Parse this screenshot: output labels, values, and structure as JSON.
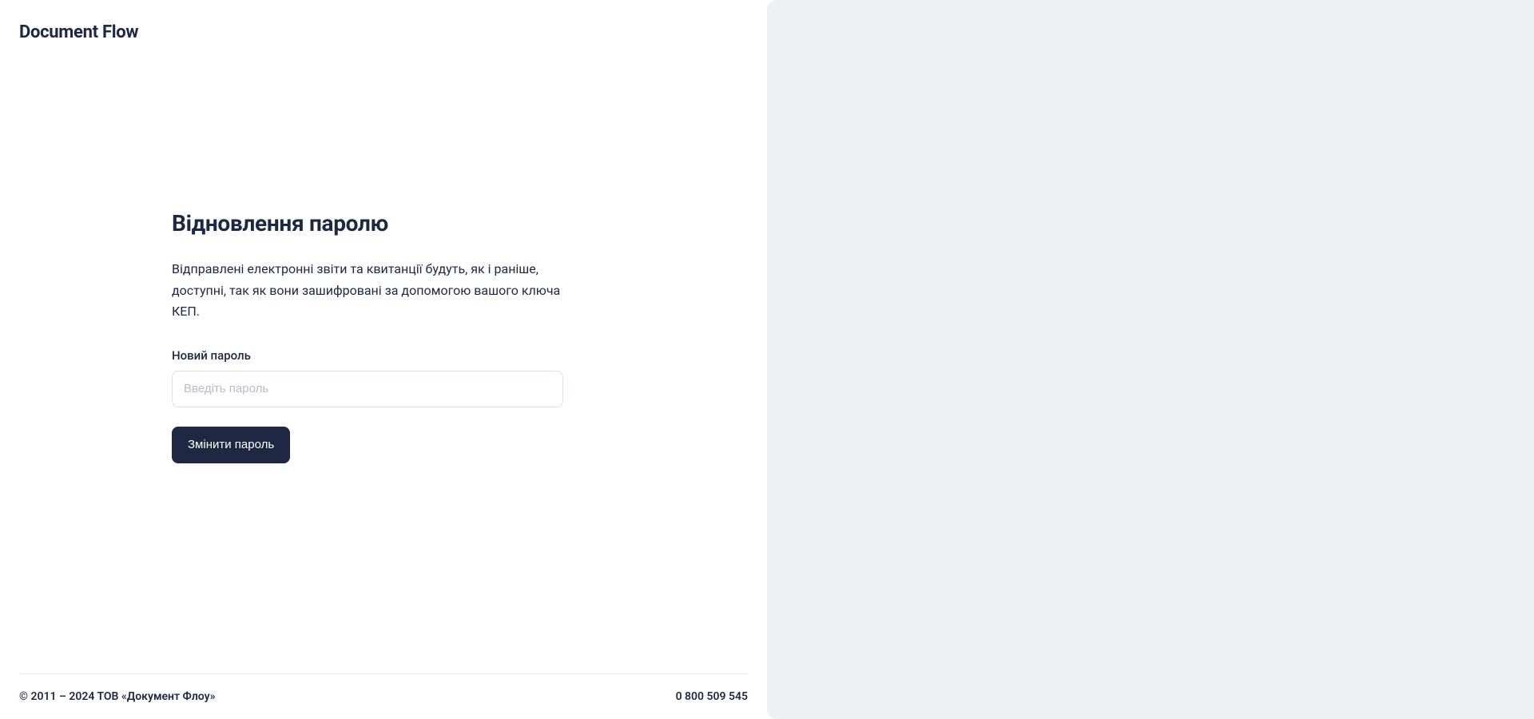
{
  "brand": {
    "name": "Document Flow"
  },
  "form": {
    "title": "Відновлення паролю",
    "description": "Відправлені електронні звіти та квитанції будуть, як і раніше, доступні, так як вони зашифровані за допомогою вашого ключа КЕП.",
    "password_label": "Новий пароль",
    "password_placeholder": "Введіть пароль",
    "submit_label": "Змінити пароль"
  },
  "footer": {
    "copyright": "© 2011 – 2024 ТОВ «Документ Флоу»",
    "phone": "0 800 509 545"
  }
}
